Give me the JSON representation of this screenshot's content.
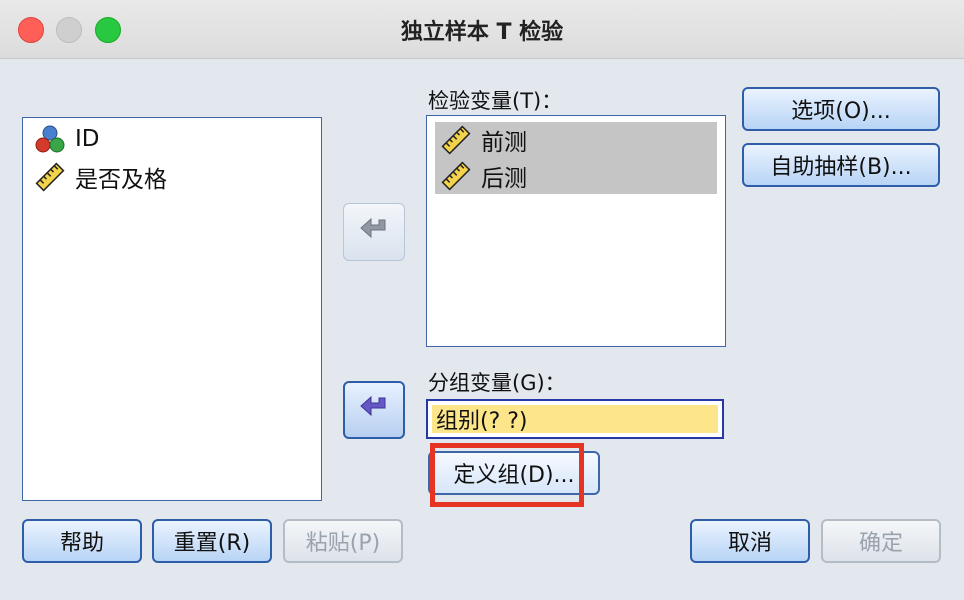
{
  "window": {
    "title": "独立样本 T 检验"
  },
  "source_list": {
    "items": [
      {
        "label": "ID",
        "icon": "nominal-variable-icon"
      },
      {
        "label": "是否及格",
        "icon": "scale-variable-icon"
      }
    ]
  },
  "test_variables": {
    "label": "检验变量(T)：",
    "items": [
      {
        "label": "前测",
        "icon": "scale-variable-icon"
      },
      {
        "label": "后测",
        "icon": "scale-variable-icon"
      }
    ]
  },
  "grouping_variable": {
    "label": "分组变量(G)：",
    "value": "组别(? ?)"
  },
  "buttons": {
    "options": "选项(O)...",
    "bootstrap": "自助抽样(B)...",
    "define_groups": "定义组(D)...",
    "help": "帮助",
    "reset": "重置(R)",
    "paste": "粘贴(P)",
    "cancel": "取消",
    "ok": "确定"
  },
  "colors": {
    "accent_border": "#2f5ea8",
    "selection_bg": "#c5c5c5",
    "group_field_bg": "#fde58a",
    "highlight_box": "#e53324"
  }
}
